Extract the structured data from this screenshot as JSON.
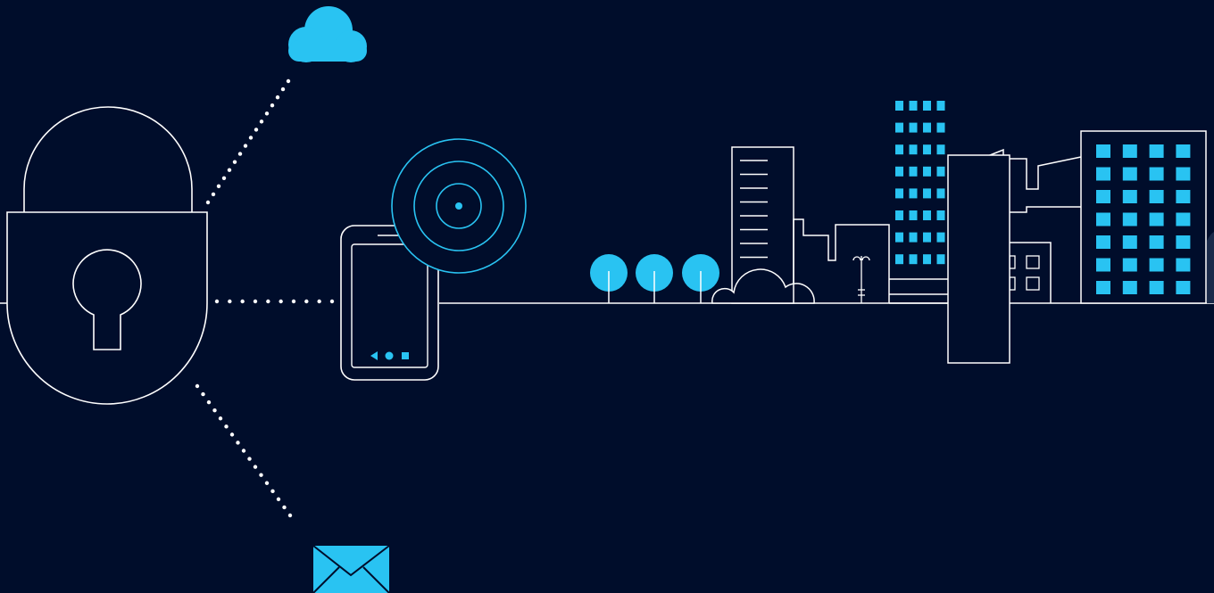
{
  "colors": {
    "background": "#000d2b",
    "line": "#ffffff",
    "accent": "#29c3f2"
  },
  "icons": {
    "padlock": "padlock-icon",
    "cloud": "cloud-icon",
    "envelope": "envelope-icon",
    "smartphone": "smartphone-icon",
    "radar": "radar-icon",
    "trees": "tree-icon",
    "city": "city-skyline-icon"
  }
}
